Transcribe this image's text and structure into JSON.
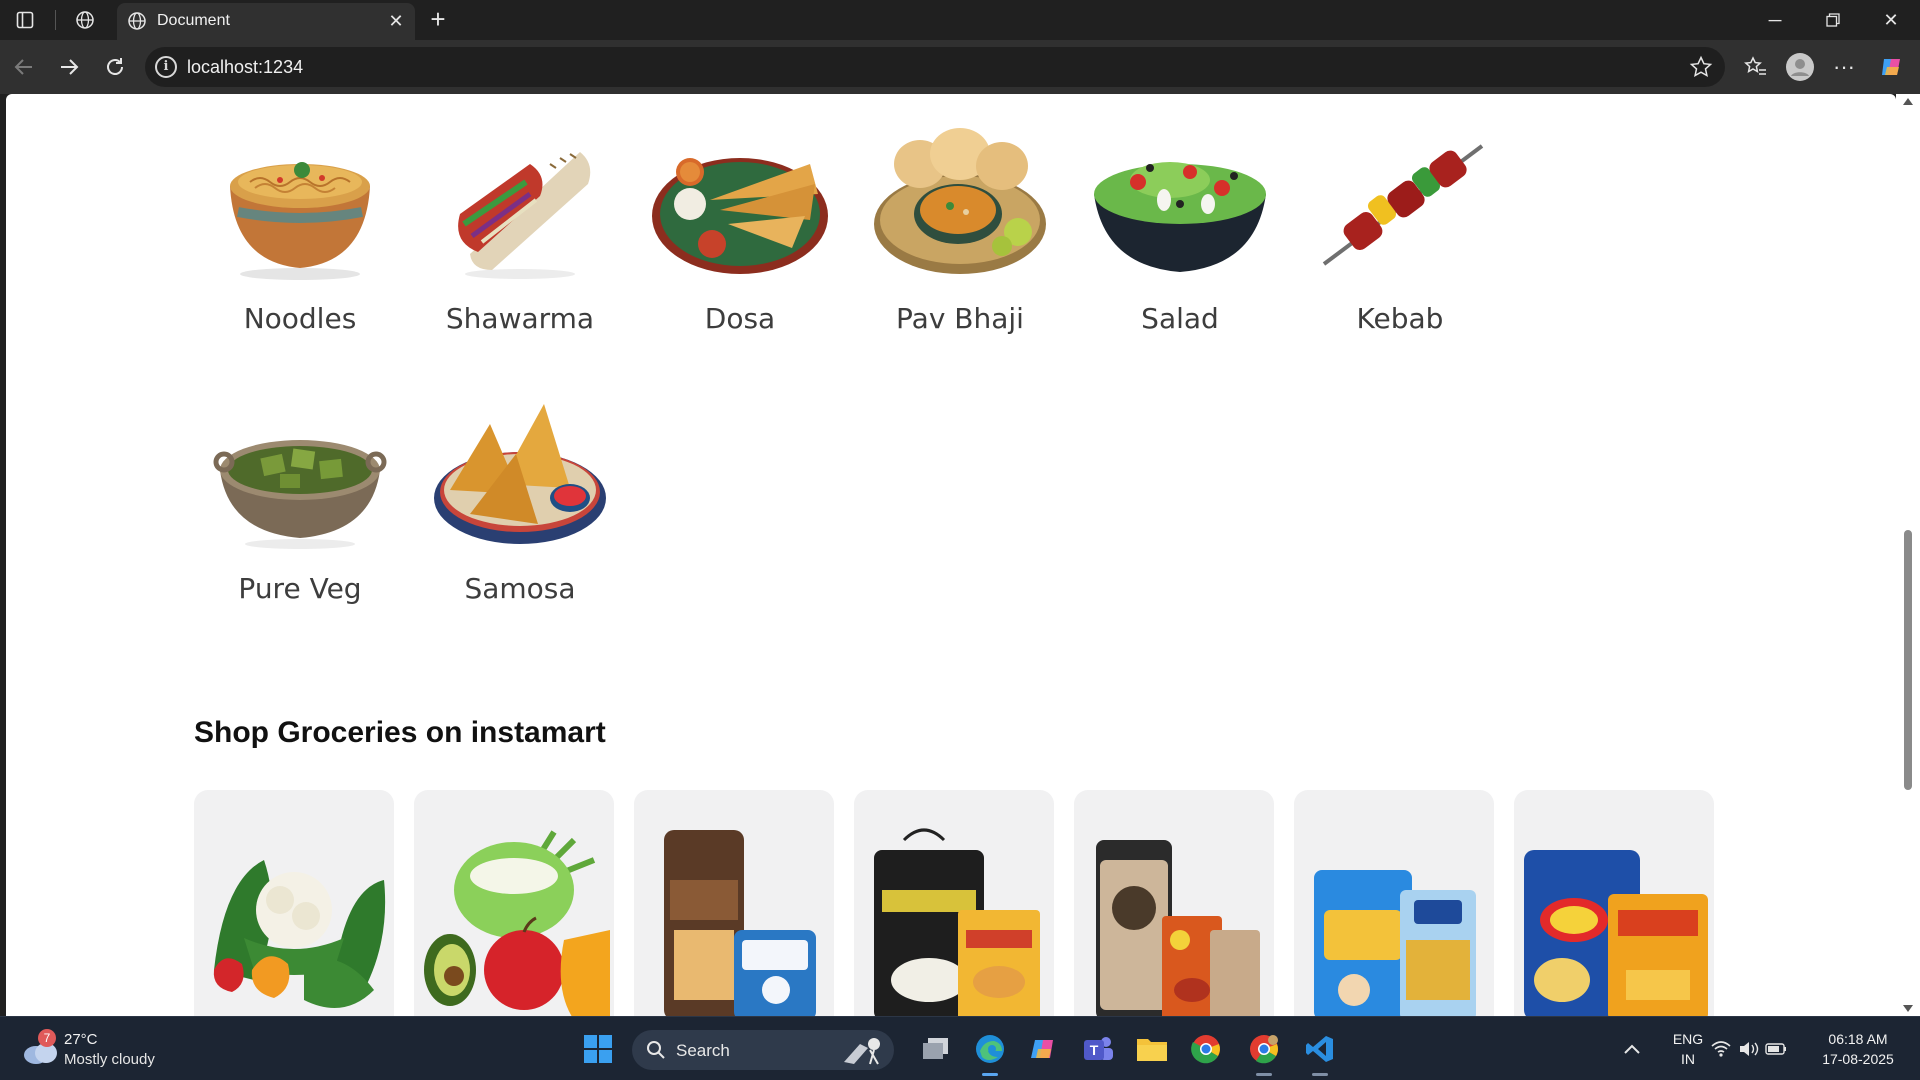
{
  "browser": {
    "tab_title": "Document",
    "url": "localhost:1234"
  },
  "page": {
    "food_items": [
      {
        "name": "Noodles",
        "icon": "noodles-bowl-image"
      },
      {
        "name": "Shawarma",
        "icon": "shawarma-wrap-image"
      },
      {
        "name": "Dosa",
        "icon": "dosa-plate-image"
      },
      {
        "name": "Pav Bhaji",
        "icon": "pav-bhaji-image"
      },
      {
        "name": "Salad",
        "icon": "salad-bowl-image"
      },
      {
        "name": "Kebab",
        "icon": "kebab-skewer-image"
      },
      {
        "name": "Pure Veg",
        "icon": "pure-veg-bowl-image"
      },
      {
        "name": "Samosa",
        "icon": "samosa-plate-image"
      }
    ],
    "grocery_section_title": "Shop Groceries on instamart",
    "grocery_cards": [
      {
        "icon": "fresh-vegetables-image"
      },
      {
        "icon": "fresh-fruits-image"
      },
      {
        "icon": "dairy-bread-eggs-image"
      },
      {
        "icon": "rice-atta-dals-image"
      },
      {
        "icon": "masalas-dry-fruits-image"
      },
      {
        "icon": "oils-ghee-image"
      },
      {
        "icon": "munchies-image"
      }
    ]
  },
  "taskbar": {
    "weather_badge": "7",
    "weather_temp": "27°C",
    "weather_desc": "Mostly cloudy",
    "search_label": "Search",
    "lang_line1": "ENG",
    "lang_line2": "IN",
    "time": "06:18 AM",
    "date": "17-08-2025"
  },
  "colors": {
    "browser_chrome": "#202020",
    "toolbar": "#303030",
    "page_bg": "#ffffff",
    "card_bg": "#f1f1f2",
    "taskbar": "#1c2533"
  }
}
